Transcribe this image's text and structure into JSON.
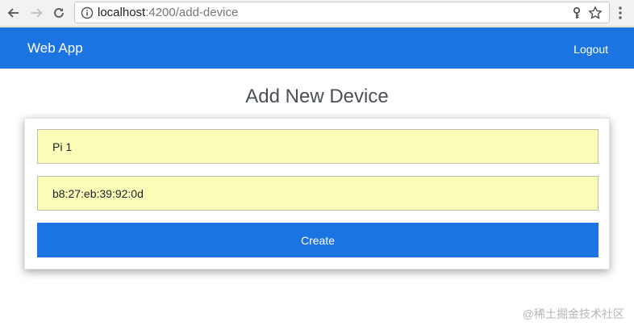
{
  "browser": {
    "url_host": "localhost",
    "url_path": ":4200/add-device",
    "icons": [
      "back-arrow-icon",
      "forward-arrow-icon",
      "reload-icon",
      "info-icon",
      "key-icon",
      "star-icon",
      "more-menu-icon"
    ]
  },
  "navbar": {
    "brand": "Web App",
    "logout": "Logout",
    "color": "#1c74e3"
  },
  "main": {
    "title": "Add New Device",
    "form": {
      "name_value": "Pi 1",
      "mac_value": "b8:27:eb:39:92:0d",
      "create_label": "Create",
      "field_color": "#fafdb8"
    }
  },
  "watermark": "@稀土掘金技术社区"
}
